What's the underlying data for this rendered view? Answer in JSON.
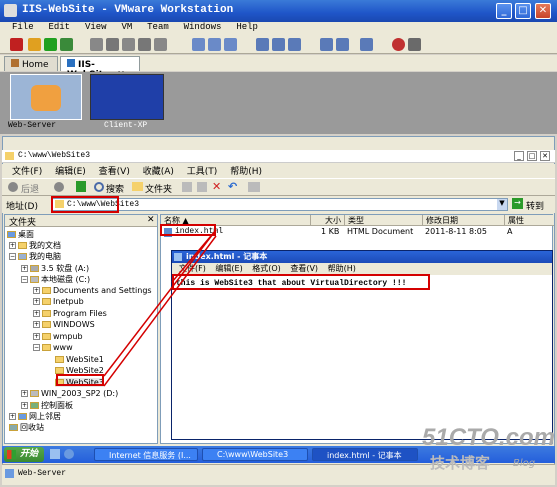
{
  "vm_window": {
    "title": "IIS-WebSite - VMware Workstation",
    "menu": [
      "File",
      "Edit",
      "View",
      "VM",
      "Team",
      "Windows",
      "Help"
    ]
  },
  "vm_tabs": [
    "Home",
    "IIS-WebSite"
  ],
  "vm_thumbnails": [
    "Web-Server",
    "Client-XP"
  ],
  "explorer": {
    "title": "C:\\www\\WebSite3",
    "menu": [
      "文件(F)",
      "编辑(E)",
      "查看(V)",
      "收藏(A)",
      "工具(T)",
      "帮助(H)"
    ],
    "toolbar": {
      "back": "后退",
      "search": "搜索",
      "folders": "文件夹"
    },
    "address_label": "地址(D)",
    "address_value": "C:\\www\\WebSite3",
    "go_label": "转到",
    "folders_header": "文件夹",
    "tree": [
      "桌面",
      "我的文档",
      "我的电脑",
      "3.5 软盘 (A:)",
      "本地磁盘 (C:)",
      "Documents and Settings",
      "Inetpub",
      "Program Files",
      "WINDOWS",
      "wmpub",
      "www",
      "WebSite1",
      "WebSite2",
      "WebSite3",
      "WIN_2003_SP2 (D:)",
      "控制面板",
      "网上邻居",
      "回收站"
    ],
    "columns": [
      "名称 ▲",
      "大小",
      "类型",
      "修改日期",
      "属性"
    ],
    "file": {
      "name": "index.html",
      "size": "1 KB",
      "type": "HTML Document",
      "date": "2011-8-11 8:05",
      "attr": "A"
    }
  },
  "notepad": {
    "title": "index.html - 记事本",
    "menu": [
      "文件(F)",
      "编辑(E)",
      "格式(O)",
      "查看(V)",
      "帮助(H)"
    ],
    "content": "this is WebSite3 that about VirtualDirectory !!!"
  },
  "taskbar": {
    "start": "开始",
    "tasks": [
      "Internet 信息服务 (I...",
      "C:\\www\\WebSite3",
      "index.html - 记事本"
    ]
  },
  "status_bar": "Web-Server",
  "watermark": {
    "main": "51CTO.com",
    "sub": "技术博客",
    "blog": "Blog"
  }
}
